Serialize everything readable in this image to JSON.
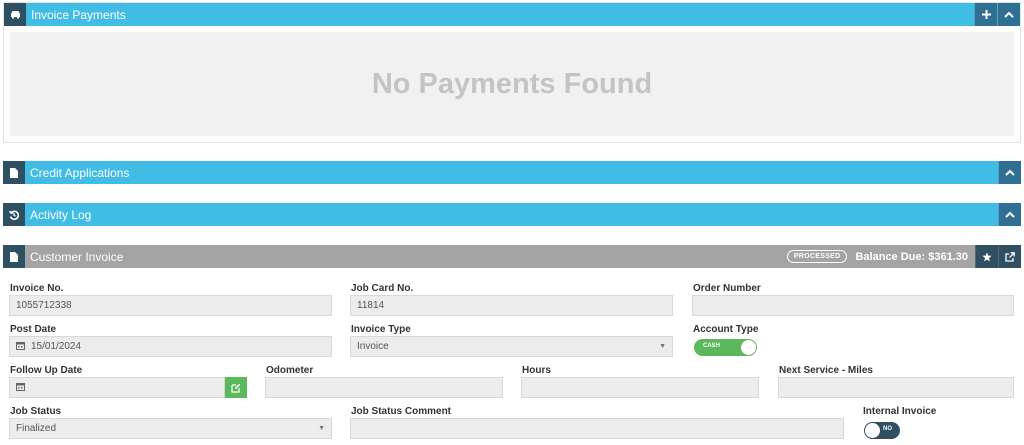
{
  "payments": {
    "title": "Invoice Payments",
    "empty_text": "No Payments Found"
  },
  "credit": {
    "title": "Credit Applications"
  },
  "activity": {
    "title": "Activity Log"
  },
  "invoice": {
    "title": "Customer Invoice",
    "status_badge": "PROCESSED",
    "balance": "Balance Due: $361.30",
    "fields": {
      "invoice_no": {
        "label": "Invoice No.",
        "value": "1055712338"
      },
      "job_card_no": {
        "label": "Job Card No.",
        "value": "11814"
      },
      "order_number": {
        "label": "Order Number",
        "value": ""
      },
      "post_date": {
        "label": "Post Date",
        "value": "15/01/2024"
      },
      "invoice_type": {
        "label": "Invoice Type",
        "value": "Invoice"
      },
      "account_type": {
        "label": "Account Type",
        "value": "CASH"
      },
      "follow_up_date": {
        "label": "Follow Up Date",
        "value": ""
      },
      "odometer": {
        "label": "Odometer",
        "value": ""
      },
      "hours": {
        "label": "Hours",
        "value": ""
      },
      "next_service": {
        "label": "Next Service - Miles",
        "value": ""
      },
      "job_status": {
        "label": "Job Status",
        "value": "Finalized"
      },
      "job_status_comment": {
        "label": "Job Status Comment",
        "value": ""
      },
      "internal_invoice": {
        "label": "Internal Invoice",
        "value": "NO"
      }
    }
  },
  "icons": [
    "car-icon",
    "plus-icon",
    "chevron-up-icon",
    "file-icon",
    "history-icon",
    "star-icon",
    "external-link-icon",
    "calendar-icon",
    "edit-icon",
    "caret-down-icon"
  ],
  "colors": {
    "header_blue": "#41bde5",
    "header_gray": "#a4a4a4",
    "dark_navy": "#2f4f63",
    "green": "#5cb85c"
  }
}
